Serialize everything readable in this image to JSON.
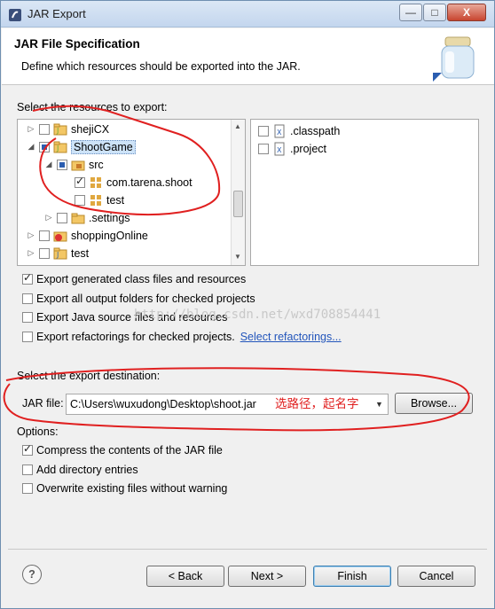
{
  "window": {
    "title": "JAR Export",
    "minimize_label": "—",
    "maximize_label": "□",
    "close_label": "X"
  },
  "header": {
    "title": "JAR File Specification",
    "description": "Define which resources should be exported into the JAR."
  },
  "resources": {
    "label": "Select the resources to export:",
    "tree": [
      {
        "label": "shejiCX",
        "toggle": "▷",
        "state": "unchecked"
      },
      {
        "label": "ShootGame",
        "toggle": "◢",
        "state": "partial",
        "selected": true
      },
      {
        "label": "src",
        "toggle": "◢",
        "state": "partial"
      },
      {
        "label": "com.tarena.shoot",
        "toggle": "",
        "state": "checked"
      },
      {
        "label": "test",
        "toggle": "",
        "state": "unchecked"
      },
      {
        "label": ".settings",
        "toggle": "▷",
        "state": "unchecked"
      },
      {
        "label": "shoppingOnline",
        "toggle": "▷",
        "state": "unchecked"
      },
      {
        "label": "test",
        "toggle": "▷",
        "state": "unchecked"
      }
    ],
    "files": [
      {
        "label": ".classpath",
        "state": "unchecked"
      },
      {
        "label": ".project",
        "state": "unchecked"
      }
    ]
  },
  "export_options": [
    {
      "label": "Export generated class files and resources",
      "checked": true
    },
    {
      "label": "Export all output folders for checked projects",
      "checked": false
    },
    {
      "label": "Export Java source files and resources",
      "checked": false
    },
    {
      "label": "Export refactorings for checked projects.",
      "checked": false
    }
  ],
  "select_refactorings_link": "Select refactorings...",
  "watermark": "http://blog.csdn.net/wxd708854441",
  "destination": {
    "label": "Select the export destination:",
    "jar_file_label": "JAR file:",
    "jar_file_value": "C:\\Users\\wuxudong\\Desktop\\shoot.jar",
    "annotation": "选路径，起名字",
    "browse_label": "Browse..."
  },
  "options": {
    "label": "Options:",
    "items": [
      {
        "label": "Compress the contents of the JAR file",
        "checked": true
      },
      {
        "label": "Add directory entries",
        "checked": false
      },
      {
        "label": "Overwrite existing files without warning",
        "checked": false
      }
    ]
  },
  "footer": {
    "help_label": "?",
    "back_label": "< Back",
    "next_label": "Next >",
    "finish_label": "Finish",
    "cancel_label": "Cancel"
  },
  "colors": {
    "annotation_red": "#e02020",
    "selection_blue": "#cde3f8",
    "link_blue": "#2255bb"
  }
}
